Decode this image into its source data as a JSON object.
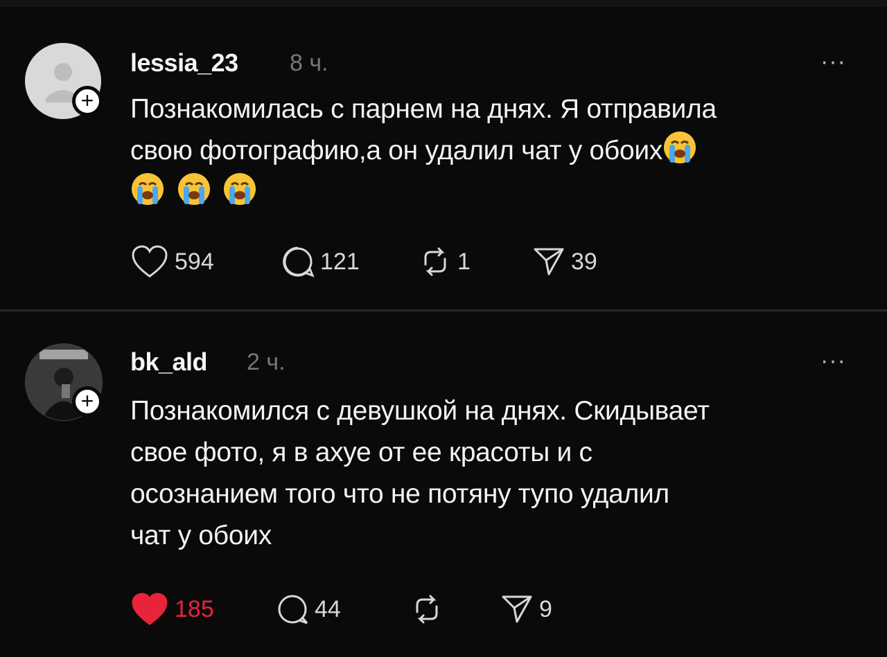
{
  "posts": [
    {
      "username": "lessia_23",
      "time": "8 ч.",
      "more": "···",
      "plus": "+",
      "text_lines": [
        "Познакомилась с парнем на днях. Я отправила",
        "свою фотографию,а он удалил чат у обоих"
      ],
      "avatar": "default-user-avatar",
      "liked": false,
      "likes": "594",
      "comments": "121",
      "reposts": "1",
      "shares": "39"
    },
    {
      "username": "bk_ald",
      "time": "2 ч.",
      "more": "···",
      "plus": "+",
      "text_lines": [
        "Познакомился с девушкой на днях. Скидывает",
        "свое фото, я в ахуе от ее красоты и с",
        "осознанием того что не потяну тупо удалил",
        "чат у обоих"
      ],
      "avatar": "photo-avatar",
      "liked": true,
      "likes": "185",
      "comments": "44",
      "reposts": "",
      "shares": "9"
    }
  ],
  "colors": {
    "background": "#0a0a0a",
    "liked": "#e8243a",
    "muted": "#777777"
  },
  "icons": [
    "heart-icon",
    "comment-icon",
    "repost-icon",
    "share-icon",
    "crying-face-emoji"
  ]
}
